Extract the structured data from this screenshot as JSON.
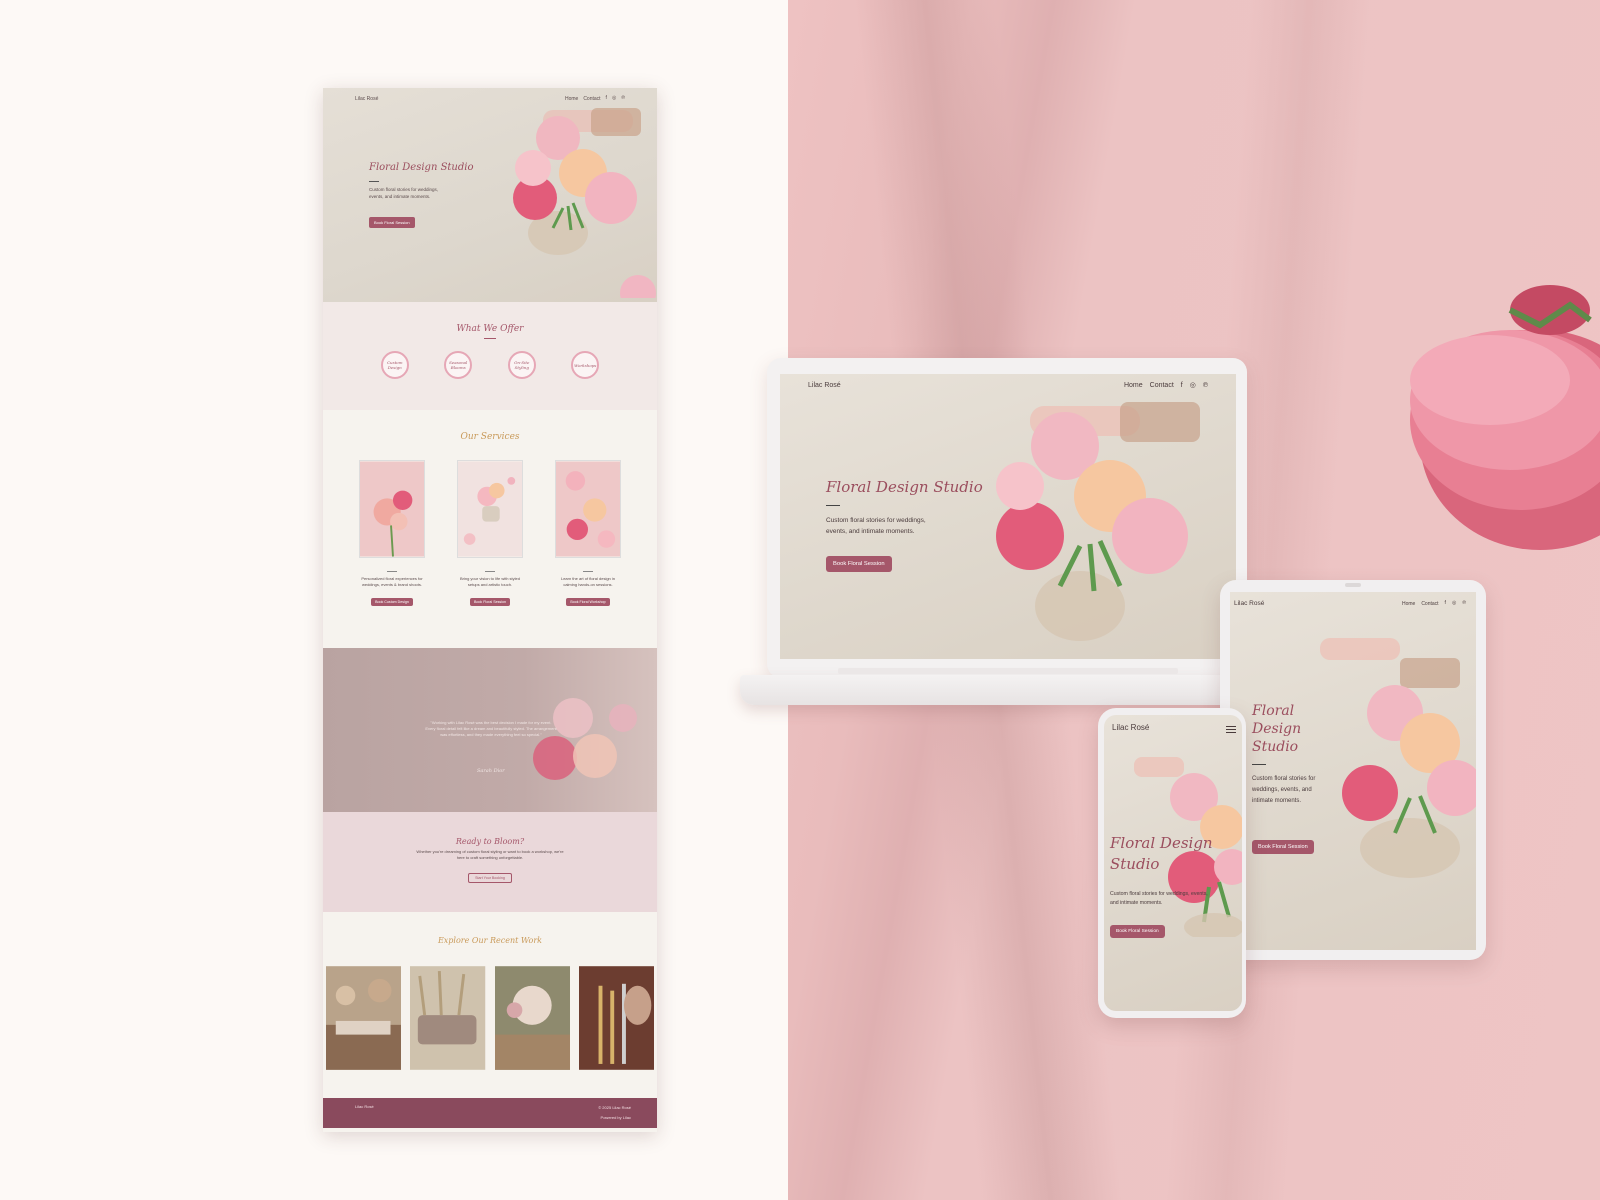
{
  "brand": "Lilac Rosé",
  "nav": {
    "home": "Home",
    "contact": "Contact"
  },
  "social": {
    "facebook": "f",
    "instagram": "◎",
    "pinterest": "℗"
  },
  "hero": {
    "title": "Floral Design Studio",
    "subtitle": "Custom floral stories for weddings, events, and intimate moments.",
    "button": "Book Floral Session"
  },
  "offer": {
    "title": "What We Offer",
    "items": [
      "Custom Design",
      "Seasonal Blooms",
      "On-Site Styling",
      "Workshops"
    ]
  },
  "services": {
    "title": "Our Services",
    "cards": [
      {
        "text": "Personalized floral experiences for weddings, events & brand shoots.",
        "button": "Book Custom Design"
      },
      {
        "text": "Bring your vision to life with styled setups and artistic touch.",
        "button": "Book Floral Session"
      },
      {
        "text": "Learn the art of floral design in calming hands-on sessions.",
        "button": "Book Floral Workshop"
      }
    ]
  },
  "testimonial": {
    "quote": "\"Working with Lilac Rosé was the best decision I made for my event. Every floral detail felt like a dream and beautifully styled. The arrangement was effortless, and they made everything feel so special.\"",
    "author": "Sarah Dior"
  },
  "bloom": {
    "title": "Ready to Bloom?",
    "text": "Whether you're dreaming of custom floral styling or want to book a workshop, we're here to craft something unforgettable.",
    "button": "Start Your Booking"
  },
  "work": {
    "title": "Explore Our Recent Work"
  },
  "footer": {
    "brand": "Lilac Rosé",
    "copyright": "© 2025 Lilac Rosé",
    "credit": "Powered by Lilac"
  },
  "colors": {
    "accent": "#a5576a",
    "footer": "#8a4a5d",
    "gold": "#c99a5a",
    "pink_bg": "#eec5c5"
  }
}
